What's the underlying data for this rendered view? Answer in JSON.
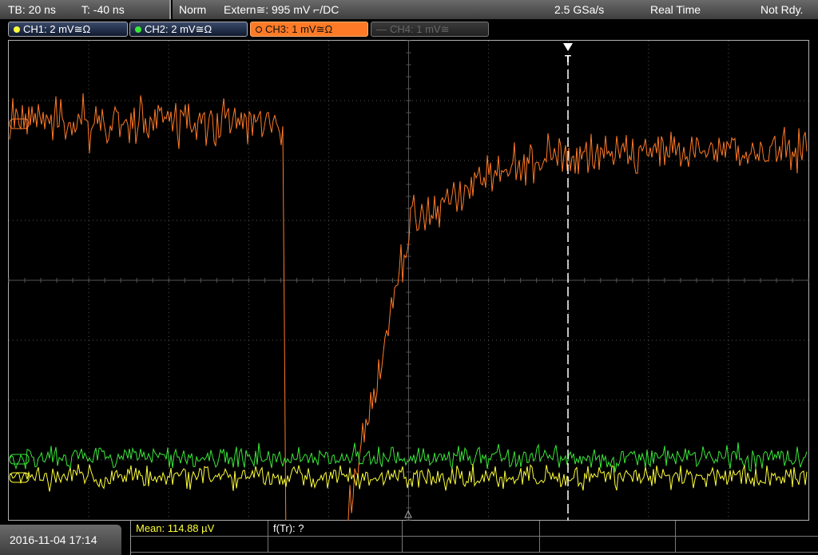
{
  "status": {
    "tb_label": "TB: 20 ns",
    "trigger_time_label": "T: -40 ns",
    "trigger_mode": "Norm",
    "trigger_source": "Extern≅: 995 mV ⌐/DC",
    "sample_rate": "2.5 GSa/s",
    "acq_mode": "Real Time",
    "ready_state": "Not Rdy."
  },
  "channels": [
    {
      "label": "CH1: 2 mV≅Ω",
      "color": "#ffff3a",
      "state": "on"
    },
    {
      "label": "CH2: 2 mV≅Ω",
      "color": "#38e838",
      "state": "on"
    },
    {
      "label": "CH3: 1 mV≅Ω",
      "color": "#ff7a26",
      "state": "active"
    },
    {
      "label": "CH4: 1 mV≅",
      "color": "#666666",
      "state": "off"
    }
  ],
  "trigger_marker": "T",
  "date_time": "2016-11-04 17:14",
  "measurements": {
    "mean_label": "Mean: 114.88 µV",
    "ftr_label": "f(Tr): ?"
  },
  "colors": {
    "ch1": "#ffff3a",
    "ch2": "#38e838",
    "ch3": "#ff7a26",
    "grid": "#555555"
  }
}
